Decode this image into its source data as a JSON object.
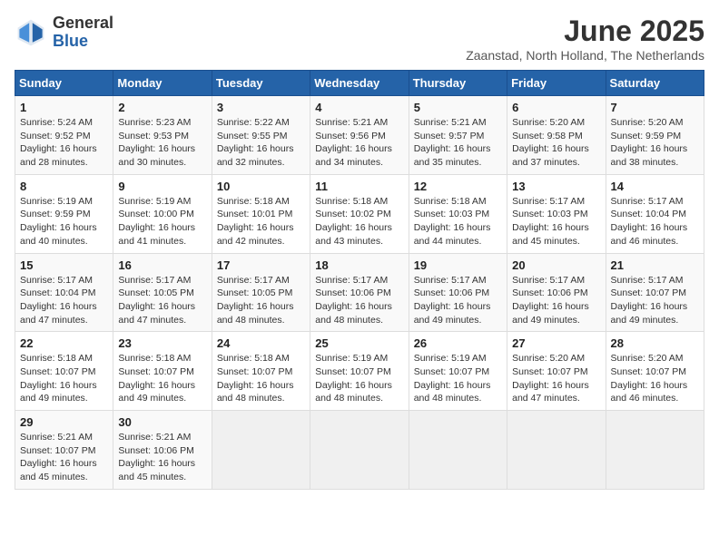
{
  "logo": {
    "line1": "General",
    "line2": "Blue"
  },
  "title": "June 2025",
  "location": "Zaanstad, North Holland, The Netherlands",
  "weekdays": [
    "Sunday",
    "Monday",
    "Tuesday",
    "Wednesday",
    "Thursday",
    "Friday",
    "Saturday"
  ],
  "weeks": [
    [
      {
        "day": "1",
        "sunrise": "Sunrise: 5:24 AM",
        "sunset": "Sunset: 9:52 PM",
        "daylight": "Daylight: 16 hours and 28 minutes."
      },
      {
        "day": "2",
        "sunrise": "Sunrise: 5:23 AM",
        "sunset": "Sunset: 9:53 PM",
        "daylight": "Daylight: 16 hours and 30 minutes."
      },
      {
        "day": "3",
        "sunrise": "Sunrise: 5:22 AM",
        "sunset": "Sunset: 9:55 PM",
        "daylight": "Daylight: 16 hours and 32 minutes."
      },
      {
        "day": "4",
        "sunrise": "Sunrise: 5:21 AM",
        "sunset": "Sunset: 9:56 PM",
        "daylight": "Daylight: 16 hours and 34 minutes."
      },
      {
        "day": "5",
        "sunrise": "Sunrise: 5:21 AM",
        "sunset": "Sunset: 9:57 PM",
        "daylight": "Daylight: 16 hours and 35 minutes."
      },
      {
        "day": "6",
        "sunrise": "Sunrise: 5:20 AM",
        "sunset": "Sunset: 9:58 PM",
        "daylight": "Daylight: 16 hours and 37 minutes."
      },
      {
        "day": "7",
        "sunrise": "Sunrise: 5:20 AM",
        "sunset": "Sunset: 9:59 PM",
        "daylight": "Daylight: 16 hours and 38 minutes."
      }
    ],
    [
      {
        "day": "8",
        "sunrise": "Sunrise: 5:19 AM",
        "sunset": "Sunset: 9:59 PM",
        "daylight": "Daylight: 16 hours and 40 minutes."
      },
      {
        "day": "9",
        "sunrise": "Sunrise: 5:19 AM",
        "sunset": "Sunset: 10:00 PM",
        "daylight": "Daylight: 16 hours and 41 minutes."
      },
      {
        "day": "10",
        "sunrise": "Sunrise: 5:18 AM",
        "sunset": "Sunset: 10:01 PM",
        "daylight": "Daylight: 16 hours and 42 minutes."
      },
      {
        "day": "11",
        "sunrise": "Sunrise: 5:18 AM",
        "sunset": "Sunset: 10:02 PM",
        "daylight": "Daylight: 16 hours and 43 minutes."
      },
      {
        "day": "12",
        "sunrise": "Sunrise: 5:18 AM",
        "sunset": "Sunset: 10:03 PM",
        "daylight": "Daylight: 16 hours and 44 minutes."
      },
      {
        "day": "13",
        "sunrise": "Sunrise: 5:17 AM",
        "sunset": "Sunset: 10:03 PM",
        "daylight": "Daylight: 16 hours and 45 minutes."
      },
      {
        "day": "14",
        "sunrise": "Sunrise: 5:17 AM",
        "sunset": "Sunset: 10:04 PM",
        "daylight": "Daylight: 16 hours and 46 minutes."
      }
    ],
    [
      {
        "day": "15",
        "sunrise": "Sunrise: 5:17 AM",
        "sunset": "Sunset: 10:04 PM",
        "daylight": "Daylight: 16 hours and 47 minutes."
      },
      {
        "day": "16",
        "sunrise": "Sunrise: 5:17 AM",
        "sunset": "Sunset: 10:05 PM",
        "daylight": "Daylight: 16 hours and 47 minutes."
      },
      {
        "day": "17",
        "sunrise": "Sunrise: 5:17 AM",
        "sunset": "Sunset: 10:05 PM",
        "daylight": "Daylight: 16 hours and 48 minutes."
      },
      {
        "day": "18",
        "sunrise": "Sunrise: 5:17 AM",
        "sunset": "Sunset: 10:06 PM",
        "daylight": "Daylight: 16 hours and 48 minutes."
      },
      {
        "day": "19",
        "sunrise": "Sunrise: 5:17 AM",
        "sunset": "Sunset: 10:06 PM",
        "daylight": "Daylight: 16 hours and 49 minutes."
      },
      {
        "day": "20",
        "sunrise": "Sunrise: 5:17 AM",
        "sunset": "Sunset: 10:06 PM",
        "daylight": "Daylight: 16 hours and 49 minutes."
      },
      {
        "day": "21",
        "sunrise": "Sunrise: 5:17 AM",
        "sunset": "Sunset: 10:07 PM",
        "daylight": "Daylight: 16 hours and 49 minutes."
      }
    ],
    [
      {
        "day": "22",
        "sunrise": "Sunrise: 5:18 AM",
        "sunset": "Sunset: 10:07 PM",
        "daylight": "Daylight: 16 hours and 49 minutes."
      },
      {
        "day": "23",
        "sunrise": "Sunrise: 5:18 AM",
        "sunset": "Sunset: 10:07 PM",
        "daylight": "Daylight: 16 hours and 49 minutes."
      },
      {
        "day": "24",
        "sunrise": "Sunrise: 5:18 AM",
        "sunset": "Sunset: 10:07 PM",
        "daylight": "Daylight: 16 hours and 48 minutes."
      },
      {
        "day": "25",
        "sunrise": "Sunrise: 5:19 AM",
        "sunset": "Sunset: 10:07 PM",
        "daylight": "Daylight: 16 hours and 48 minutes."
      },
      {
        "day": "26",
        "sunrise": "Sunrise: 5:19 AM",
        "sunset": "Sunset: 10:07 PM",
        "daylight": "Daylight: 16 hours and 48 minutes."
      },
      {
        "day": "27",
        "sunrise": "Sunrise: 5:20 AM",
        "sunset": "Sunset: 10:07 PM",
        "daylight": "Daylight: 16 hours and 47 minutes."
      },
      {
        "day": "28",
        "sunrise": "Sunrise: 5:20 AM",
        "sunset": "Sunset: 10:07 PM",
        "daylight": "Daylight: 16 hours and 46 minutes."
      }
    ],
    [
      {
        "day": "29",
        "sunrise": "Sunrise: 5:21 AM",
        "sunset": "Sunset: 10:07 PM",
        "daylight": "Daylight: 16 hours and 45 minutes."
      },
      {
        "day": "30",
        "sunrise": "Sunrise: 5:21 AM",
        "sunset": "Sunset: 10:06 PM",
        "daylight": "Daylight: 16 hours and 45 minutes."
      },
      null,
      null,
      null,
      null,
      null
    ]
  ]
}
